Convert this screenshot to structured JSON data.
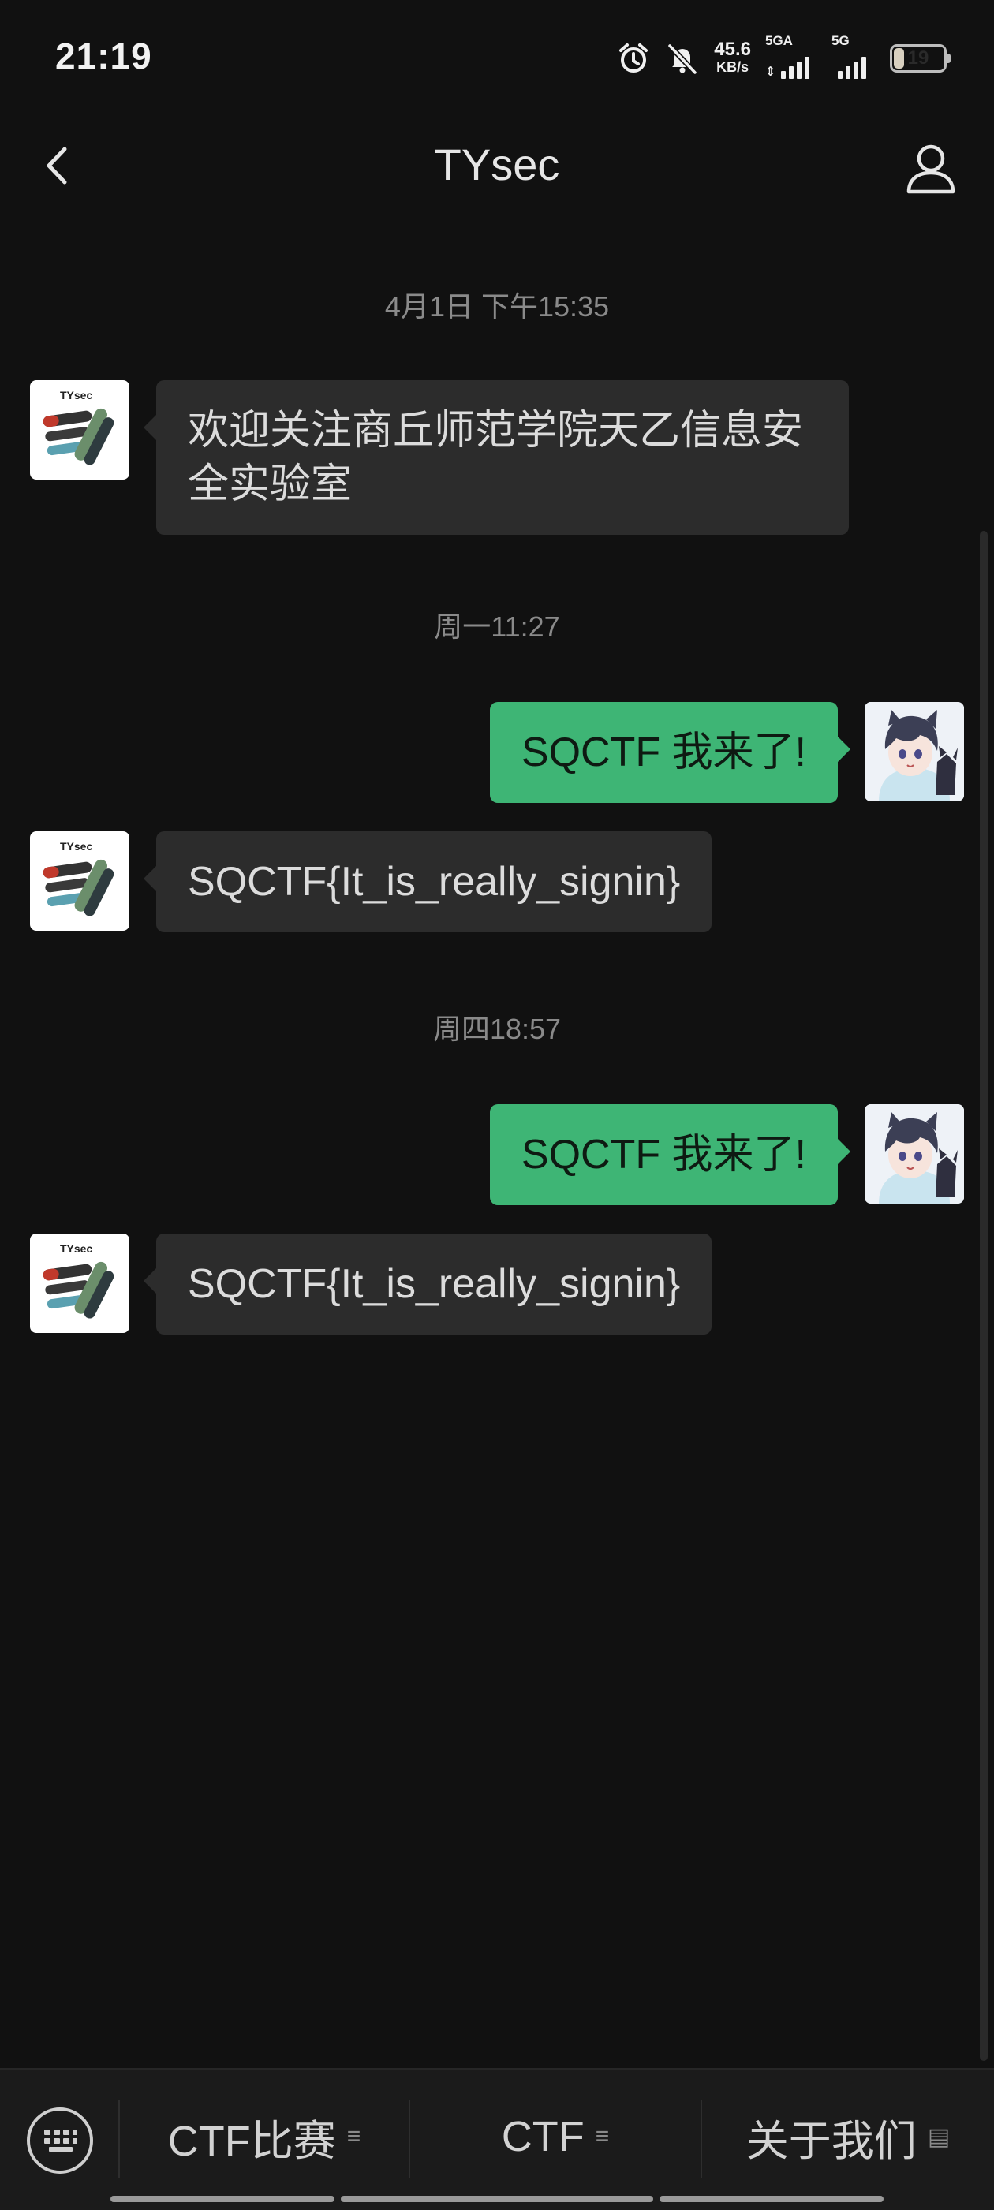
{
  "status_bar": {
    "time": "21:19",
    "net_speed_value": "45.6",
    "net_speed_unit": "KB/s",
    "sim1_label": "5GA",
    "sim2_label": "5G",
    "battery": "19",
    "battery_fraction": 0.19,
    "icons": [
      "alarm-icon",
      "mute-icon",
      "signal-icon",
      "battery-icon"
    ]
  },
  "header": {
    "title": "TYsec",
    "back_icon": "chevron-left-icon",
    "profile_icon": "person-icon"
  },
  "messages": [
    {
      "type": "timestamp",
      "text": "4月1日 下午15:35"
    },
    {
      "type": "incoming",
      "lines": [
        "欢迎关注商丘师范学院天乙信息安",
        "全实验室"
      ]
    },
    {
      "type": "timestamp",
      "text": "周一11:27"
    },
    {
      "type": "outgoing",
      "text": "SQCTF 我来了!"
    },
    {
      "type": "incoming",
      "text": "SQCTF{It_is_really_signin}"
    },
    {
      "type": "timestamp",
      "text": "周四18:57"
    },
    {
      "type": "outgoing",
      "text": "SQCTF 我来了!"
    },
    {
      "type": "incoming",
      "text": "SQCTF{It_is_really_signin}"
    }
  ],
  "brand_logo_text": "TYsec",
  "bottom_menu": {
    "keyboard_icon": "keyboard-icon",
    "items": [
      {
        "label": "CTF比赛",
        "mark": "≡"
      },
      {
        "label": "CTF",
        "mark": "≡"
      },
      {
        "label": "关于我们",
        "mark": "▤"
      }
    ]
  },
  "colors": {
    "background": "#111111",
    "incoming_bubble": "#2c2c2c",
    "outgoing_bubble": "#3eb575",
    "timestamp": "#8a8a8a"
  }
}
